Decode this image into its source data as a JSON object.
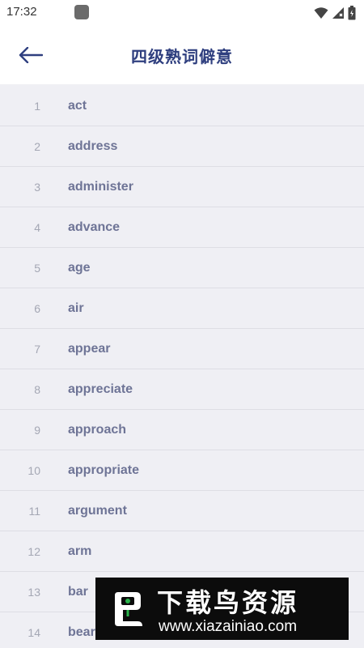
{
  "status_bar": {
    "time": "17:32",
    "icons": [
      "app-notification-icon",
      "wifi-icon",
      "signal-icon",
      "battery-icon"
    ]
  },
  "header": {
    "back_icon": "arrow-left-icon",
    "title": "四级熟词僻意"
  },
  "words": [
    {
      "num": "1",
      "word": "act"
    },
    {
      "num": "2",
      "word": "address"
    },
    {
      "num": "3",
      "word": "administer"
    },
    {
      "num": "4",
      "word": "advance"
    },
    {
      "num": "5",
      "word": "age"
    },
    {
      "num": "6",
      "word": "air"
    },
    {
      "num": "7",
      "word": "appear"
    },
    {
      "num": "8",
      "word": "appreciate"
    },
    {
      "num": "9",
      "word": "approach"
    },
    {
      "num": "10",
      "word": "appropriate"
    },
    {
      "num": "11",
      "word": "argument"
    },
    {
      "num": "12",
      "word": "arm"
    },
    {
      "num": "13",
      "word": "bar"
    },
    {
      "num": "14",
      "word": "bear"
    }
  ],
  "watermark": {
    "title": "下载鸟资源",
    "url": "www.xiazainiao.com"
  },
  "colors": {
    "title": "#2f3f7f",
    "word": "#6e7496",
    "number": "#a4a7b4",
    "background": "#efeff4"
  }
}
